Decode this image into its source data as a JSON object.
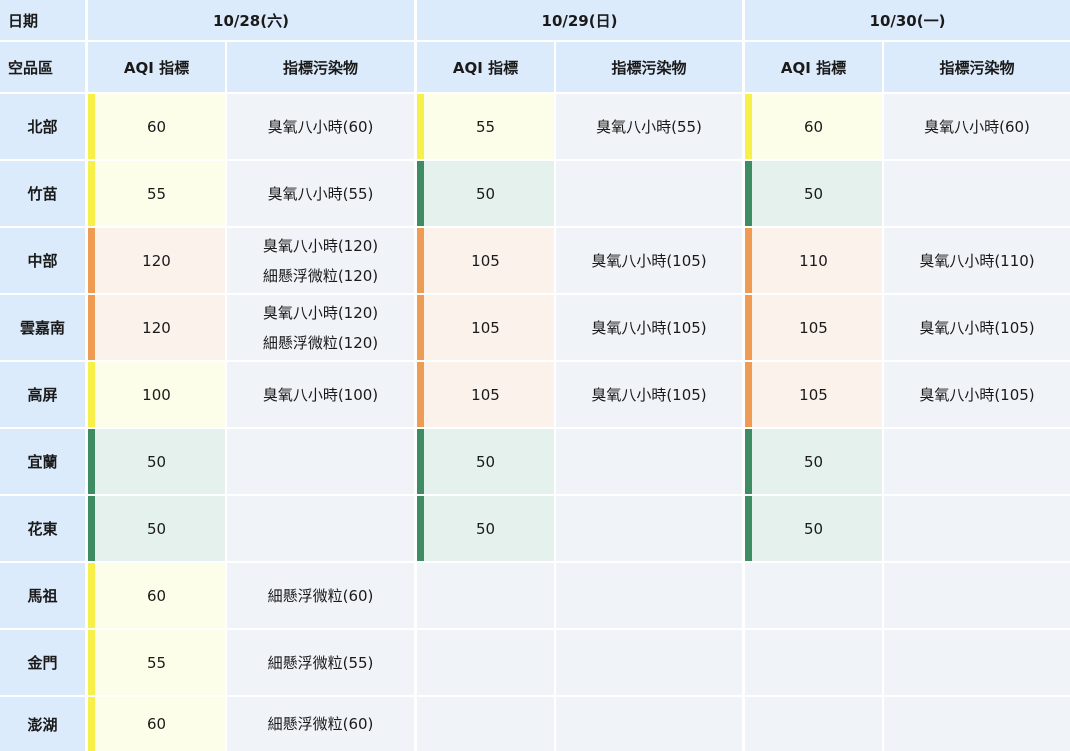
{
  "header": {
    "date_label": "日期",
    "area_label": "空品區",
    "dates": [
      "10/28(六)",
      "10/29(日)",
      "10/30(一)"
    ],
    "aqi_label": "AQI 指標",
    "pollutant_label": "指標污染物"
  },
  "levels": {
    "good": {
      "bar": "#3d8c63",
      "bg": "#e5f1ec"
    },
    "moderate": {
      "bar": "#f8f04a",
      "bg": "#fdfee9"
    },
    "sensitive": {
      "bar": "#ee9c54",
      "bg": "#fcf2ec"
    }
  },
  "rows": [
    {
      "area": "北部",
      "days": [
        {
          "aqi": "60",
          "level": "moderate",
          "pollutants": [
            "臭氧八小時(60)"
          ]
        },
        {
          "aqi": "55",
          "level": "moderate",
          "pollutants": [
            "臭氧八小時(55)"
          ]
        },
        {
          "aqi": "60",
          "level": "moderate",
          "pollutants": [
            "臭氧八小時(60)"
          ]
        }
      ]
    },
    {
      "area": "竹苗",
      "days": [
        {
          "aqi": "55",
          "level": "moderate",
          "pollutants": [
            "臭氧八小時(55)"
          ]
        },
        {
          "aqi": "50",
          "level": "good",
          "pollutants": []
        },
        {
          "aqi": "50",
          "level": "good",
          "pollutants": []
        }
      ]
    },
    {
      "area": "中部",
      "days": [
        {
          "aqi": "120",
          "level": "sensitive",
          "pollutants": [
            "臭氧八小時(120)",
            "細懸浮微粒(120)"
          ]
        },
        {
          "aqi": "105",
          "level": "sensitive",
          "pollutants": [
            "臭氧八小時(105)"
          ]
        },
        {
          "aqi": "110",
          "level": "sensitive",
          "pollutants": [
            "臭氧八小時(110)"
          ]
        }
      ]
    },
    {
      "area": "雲嘉南",
      "days": [
        {
          "aqi": "120",
          "level": "sensitive",
          "pollutants": [
            "臭氧八小時(120)",
            "細懸浮微粒(120)"
          ]
        },
        {
          "aqi": "105",
          "level": "sensitive",
          "pollutants": [
            "臭氧八小時(105)"
          ]
        },
        {
          "aqi": "105",
          "level": "sensitive",
          "pollutants": [
            "臭氧八小時(105)"
          ]
        }
      ]
    },
    {
      "area": "高屏",
      "days": [
        {
          "aqi": "100",
          "level": "moderate",
          "pollutants": [
            "臭氧八小時(100)"
          ]
        },
        {
          "aqi": "105",
          "level": "sensitive",
          "pollutants": [
            "臭氧八小時(105)"
          ]
        },
        {
          "aqi": "105",
          "level": "sensitive",
          "pollutants": [
            "臭氧八小時(105)"
          ]
        }
      ]
    },
    {
      "area": "宜蘭",
      "days": [
        {
          "aqi": "50",
          "level": "good",
          "pollutants": []
        },
        {
          "aqi": "50",
          "level": "good",
          "pollutants": []
        },
        {
          "aqi": "50",
          "level": "good",
          "pollutants": []
        }
      ]
    },
    {
      "area": "花東",
      "days": [
        {
          "aqi": "50",
          "level": "good",
          "pollutants": []
        },
        {
          "aqi": "50",
          "level": "good",
          "pollutants": []
        },
        {
          "aqi": "50",
          "level": "good",
          "pollutants": []
        }
      ]
    },
    {
      "area": "馬祖",
      "days": [
        {
          "aqi": "60",
          "level": "moderate",
          "pollutants": [
            "細懸浮微粒(60)"
          ]
        },
        null,
        null
      ]
    },
    {
      "area": "金門",
      "days": [
        {
          "aqi": "55",
          "level": "moderate",
          "pollutants": [
            "細懸浮微粒(55)"
          ]
        },
        null,
        null
      ]
    },
    {
      "area": "澎湖",
      "days": [
        {
          "aqi": "60",
          "level": "moderate",
          "pollutants": [
            "細懸浮微粒(60)"
          ]
        },
        null,
        null
      ]
    }
  ]
}
